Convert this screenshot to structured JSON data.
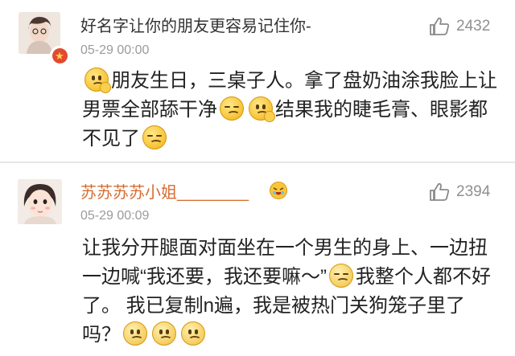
{
  "comments": [
    {
      "username": "好名字让你的朋友更容易记住你-",
      "timestamp": "05-29 00:00",
      "likes": "2432",
      "text_parts": [
        "朋友生日，三桌子人。拿了盘奶油涂我脸上让男票全部舔干净",
        "结果我的睫毛膏、眼影都不见了"
      ]
    },
    {
      "username": "苏苏苏苏小姐________",
      "timestamp": "05-29 00:09",
      "likes": "2394",
      "text_parts": [
        "让我分开腿面对面坐在一个男生的身上、一边扭一边喊“我还要，我还要嘛～”",
        "我整个人都不好了。 我已复制n遍，我是被热门关狗笼子里了吗？"
      ]
    }
  ],
  "icons": {
    "like": "thumbs-up-icon",
    "badge": "verified-star-badge-icon",
    "vip": "vip-emoji-icon",
    "emoji": "emoji-face-icon"
  },
  "colors": {
    "username_default": "#333333",
    "username_member": "#d66c2f",
    "timestamp": "#9b9b9b",
    "like": "#909090"
  }
}
